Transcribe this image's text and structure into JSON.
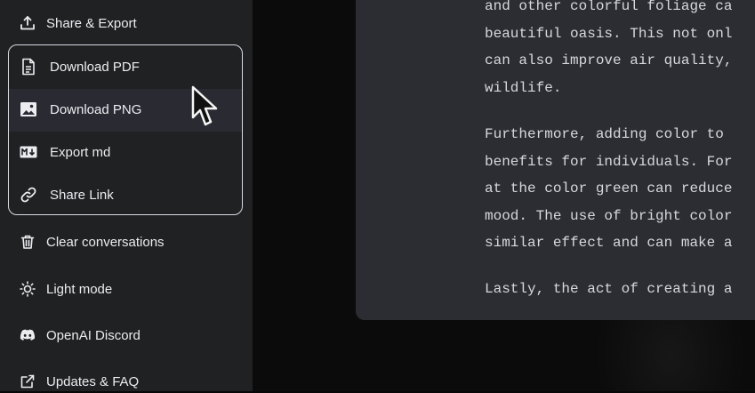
{
  "sidebar": {
    "share_export": "Share & Export",
    "submenu": {
      "items": [
        {
          "label": "Download PDF",
          "icon": "file-text-icon"
        },
        {
          "label": "Download PNG",
          "icon": "image-icon"
        },
        {
          "label": "Export md",
          "icon": "markdown-icon"
        },
        {
          "label": "Share Link",
          "icon": "link-icon"
        }
      ]
    },
    "clear_conversations": "Clear conversations",
    "light_mode": "Light mode",
    "openai_discord": "OpenAI Discord",
    "updates_faq": "Updates & FAQ"
  },
  "document": {
    "lines": [
      "and other colorful foliage ca",
      "beautiful oasis. This not onl",
      "can also improve air quality,",
      "wildlife.",
      "Furthermore, adding color to",
      "benefits for individuals. For",
      "at the color green can reduce",
      "mood. The use of bright color",
      "similar effect and can make a",
      "Lastly, the act of creating a"
    ]
  },
  "colors": {
    "sidebar_bg": "#202123",
    "doc_bg": "#2c2d33",
    "text": "#ececf1"
  }
}
